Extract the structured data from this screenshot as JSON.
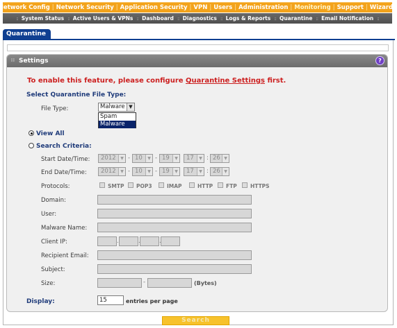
{
  "top_nav": {
    "items": [
      "Network Config",
      "Network Security",
      "Application Security",
      "VPN",
      "Users",
      "Administration",
      "Monitoring",
      "Support",
      "Wizards"
    ],
    "active": "Monitoring"
  },
  "sub_nav": {
    "items": [
      "System Status",
      "Active Users & VPNs",
      "Dashboard",
      "Diagnostics",
      "Logs & Reports",
      "Quarantine",
      "Email Notification"
    ]
  },
  "tab": {
    "label": "Quarantine"
  },
  "settings": {
    "title": "Settings",
    "help_icon": "help-icon",
    "warning_prefix": "To enable this feature, please configure ",
    "warning_link": "Quarantine Settings",
    "warning_suffix": " first.",
    "file_type_section": "Select Quarantine File Type:",
    "file_type_label": "File Type:",
    "file_type_value": "Malware",
    "file_type_options": [
      "Spam",
      "Malware"
    ],
    "view_all_label": "View All",
    "search_criteria_label": "Search Criteria:",
    "start_label": "Start Date/Time:",
    "end_label": "End Date/Time:",
    "start": {
      "year": "2012",
      "month": "10",
      "day": "19",
      "hour": "17",
      "minute": "26"
    },
    "end": {
      "year": "2012",
      "month": "10",
      "day": "19",
      "hour": "17",
      "minute": "26"
    },
    "protocols_label": "Protocols:",
    "protocols": [
      "SMTP",
      "POP3",
      "IMAP",
      "HTTP",
      "FTP",
      "HTTPS"
    ],
    "domain_label": "Domain:",
    "user_label": "User:",
    "malware_name_label": "Malware Name:",
    "client_ip_label": "Client IP:",
    "recipient_label": "Recipient Email:",
    "subject_label": "Subject:",
    "size_label": "Size:",
    "size_unit": "(Bytes)",
    "display_label": "Display:",
    "display_value": "15",
    "display_suffix": "entries per page"
  },
  "search_button": "Search",
  "colors": {
    "nav_orange": "#f3a31b",
    "tab_blue": "#0f3f91",
    "warning_red": "#cc1f1f"
  }
}
